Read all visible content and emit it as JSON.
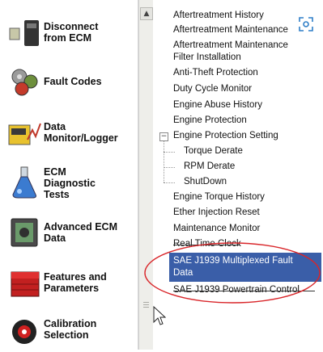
{
  "left_nav": {
    "items": [
      {
        "label": "Disconnect\nfrom ECM",
        "icon": "disconnect-icon"
      },
      {
        "label": "Fault Codes",
        "icon": "fault-codes-icon"
      },
      {
        "label": "Data\nMonitor/Logger",
        "icon": "data-monitor-icon"
      },
      {
        "label": "ECM\nDiagnostic\nTests",
        "icon": "diagnostic-tests-icon"
      },
      {
        "label": "Advanced ECM\nData",
        "icon": "advanced-ecm-icon"
      },
      {
        "label": "Features and\nParameters",
        "icon": "features-parameters-icon"
      },
      {
        "label": "Calibration\nSelection",
        "icon": "calibration-icon"
      }
    ]
  },
  "scrollbar": {
    "up_arrow": "▲"
  },
  "tree": {
    "expander_minus": "−",
    "items": [
      {
        "label": "Aftertreatment History"
      },
      {
        "label": "Aftertreatment Maintenance"
      },
      {
        "label": "Aftertreatment Maintenance\nFilter Installation"
      },
      {
        "label": "Anti-Theft Protection"
      },
      {
        "label": "Duty Cycle Monitor"
      },
      {
        "label": "Engine Abuse History"
      },
      {
        "label": "Engine Protection"
      },
      {
        "label": "Engine Protection Setting"
      },
      {
        "label": "Torque Derate"
      },
      {
        "label": "RPM Derate"
      },
      {
        "label": "ShutDown"
      },
      {
        "label": "Engine Torque History"
      },
      {
        "label": "Ether Injection Reset"
      },
      {
        "label": "Maintenance Monitor"
      },
      {
        "label": "Real Time Clock"
      },
      {
        "label": "SAE J1939 Multiplexed Fault\nData"
      },
      {
        "label": "SAE J1939 Powertrain Control"
      }
    ]
  },
  "colors": {
    "selection": "#3a5ea8",
    "annotation_ellipse": "#d9262a"
  }
}
